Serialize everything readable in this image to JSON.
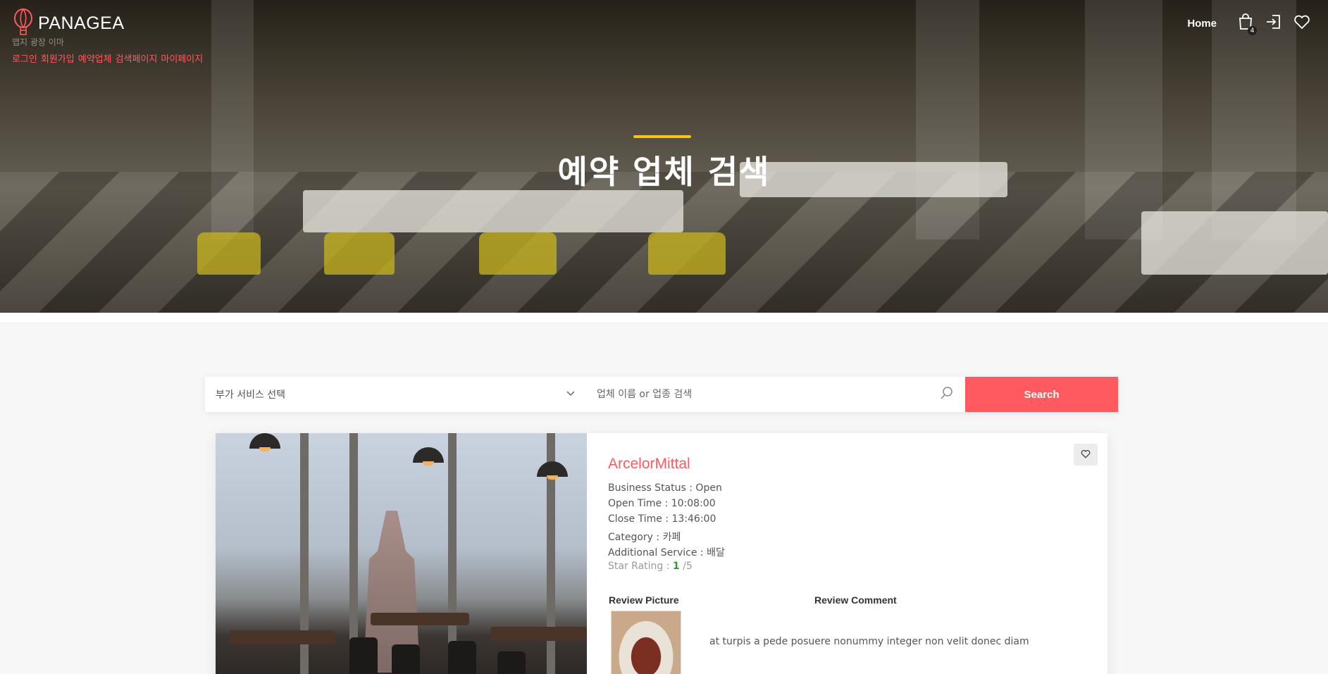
{
  "brand": {
    "name": "PANAGEA"
  },
  "header": {
    "faded_text": "맵지 광장 이마",
    "subnav": [
      "로그인",
      "회원가입",
      "예약업체",
      "검색페이지",
      "마이페이지"
    ],
    "home_label": "Home",
    "cart_count": "4"
  },
  "hero": {
    "title": "예약 업체 검색"
  },
  "search": {
    "select_label": "부가 서비스 선택",
    "input_placeholder": "업체 이름 or 업종 검색",
    "button_label": "Search"
  },
  "result": {
    "name": "ArcelorMittal",
    "business_status_label": "Business Status :",
    "business_status": "Open",
    "open_time_label": "Open Time :",
    "open_time": "10:08:00",
    "close_time_label": "Close Time :",
    "close_time": "13:46:00",
    "category_label": "Category :",
    "category": "카페",
    "additional_service_label": "Additional Service :",
    "additional_service": "배달",
    "star_rating_label": "Star Rating :",
    "star_rating": "1",
    "star_rating_max": "/5",
    "review_picture_label": "Review Picture",
    "review_comment_label": "Review Comment",
    "review_comment": "at turpis a pede posuere nonummy integer non velit donec diam"
  },
  "colors": {
    "accent": "#ff5a5f",
    "hero_bar": "#f9c414",
    "rating": "#2e9a3a"
  }
}
